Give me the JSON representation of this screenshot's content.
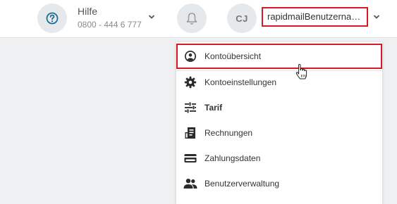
{
  "header": {
    "help": {
      "icon": "question-circle-icon",
      "title": "Hilfe",
      "phone": "0800 - 444 6 777"
    },
    "notifications_icon": "bell-icon",
    "avatar_initials": "CJ",
    "username": "rapidmailBenutzerna…"
  },
  "account_menu": {
    "items": [
      {
        "label": "Kontoübersicht",
        "icon": "account-circle-icon",
        "active": true
      },
      {
        "label": "Kontoeinstellungen",
        "icon": "gear-icon"
      },
      {
        "label": "Tarif",
        "icon": "sliders-icon"
      },
      {
        "label": "Rechnungen",
        "icon": "invoice-icon"
      },
      {
        "label": "Zahlungsdaten",
        "icon": "credit-card-icon"
      },
      {
        "label": "Benutzerverwaltung",
        "icon": "users-icon"
      }
    ]
  },
  "colors": {
    "highlight": "#d51a2a",
    "help_accent": "#1d6d94",
    "background": "#eff0f2"
  }
}
